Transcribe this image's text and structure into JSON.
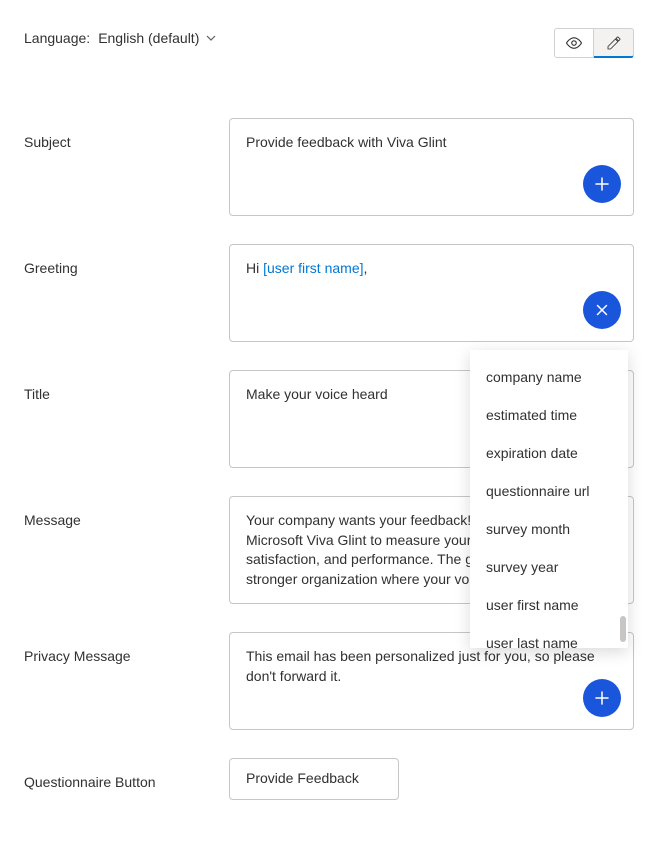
{
  "header": {
    "language_label": "Language:",
    "language_value": "English (default)"
  },
  "fields": {
    "subject": {
      "label": "Subject",
      "value": "Provide feedback with Viva Glint"
    },
    "greeting": {
      "label": "Greeting",
      "prefix": "Hi ",
      "macro": "[user first name]",
      "suffix": ","
    },
    "title": {
      "label": "Title",
      "value": "Make your voice heard"
    },
    "message": {
      "label": "Message",
      "value": "Your company wants your feedback! We are partnering with Microsoft Viva Glint to measure your engagement, satisfaction, and performance. The goal is to create a stronger organization where your voice matters."
    },
    "privacy": {
      "label": "Privacy Message",
      "value": "This email has been personalized just for you, so please don't forward it."
    },
    "button": {
      "label": "Questionnaire Button",
      "value": "Provide Feedback"
    }
  },
  "macro_dropdown": {
    "items": [
      "company name",
      "estimated time",
      "expiration date",
      "questionnaire url",
      "survey month",
      "survey year",
      "user first name",
      "user last name"
    ]
  }
}
